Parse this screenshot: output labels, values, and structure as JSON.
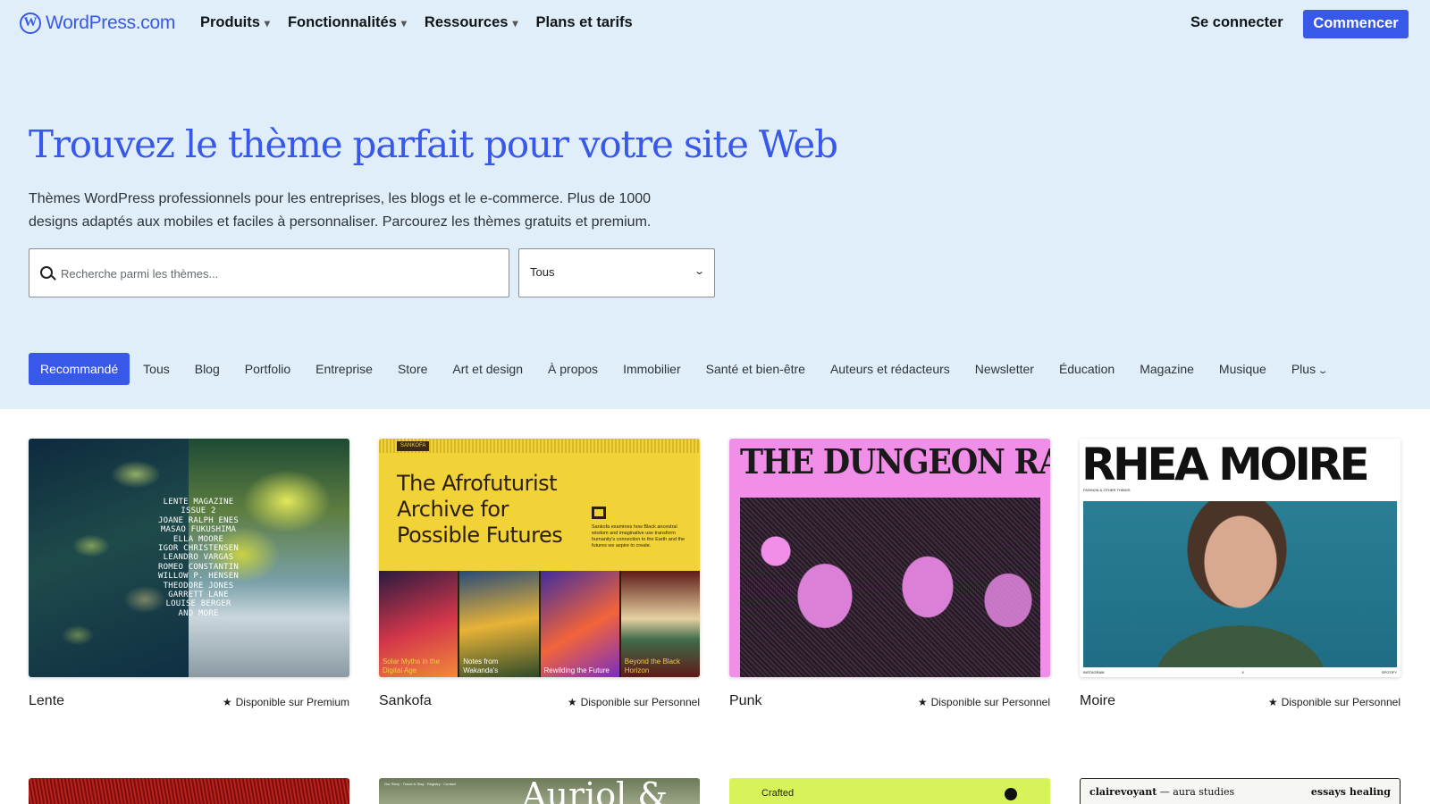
{
  "nav": {
    "logo": "WordPress.com",
    "links": [
      {
        "label": "Produits",
        "caret": "▾"
      },
      {
        "label": "Fonctionnalités",
        "caret": "▾"
      },
      {
        "label": "Ressources",
        "caret": "▾"
      },
      {
        "label": "Plans et tarifs",
        "caret": ""
      }
    ],
    "login": "Se connecter",
    "cta": "Commencer"
  },
  "hero": {
    "title": "Trouvez le thème parfait pour votre site Web",
    "description": "Thèmes WordPress professionnels pour les entreprises, les blogs et le e-commerce. Plus de 1000 designs adaptés aux mobiles et faciles à personnaliser. Parcourez les thèmes gratuits et premium.",
    "search_placeholder": "Recherche parmi les thèmes...",
    "search_value": "",
    "filter_value": "Tous"
  },
  "categories": {
    "items": [
      "Recommandé",
      "Tous",
      "Blog",
      "Portfolio",
      "Entreprise",
      "Store",
      "Art et design",
      "À propos",
      "Immobilier",
      "Santé et bien-être",
      "Auteurs et rédacteurs",
      "Newsletter",
      "Éducation",
      "Magazine",
      "Musique"
    ],
    "active": "Recommandé",
    "more": "Plus"
  },
  "themes": [
    {
      "name": "Lente",
      "badge": "Disponible sur Premium"
    },
    {
      "name": "Sankofa",
      "badge": "Disponible sur Personnel"
    },
    {
      "name": "Punk",
      "badge": "Disponible sur Personnel"
    },
    {
      "name": "Moire",
      "badge": "Disponible sur Personnel"
    }
  ],
  "previews": {
    "lente": {
      "lines": [
        "LENTE MAGAZINE",
        "ISSUE 2",
        "JOANE RALPH ENES",
        "MASAO FUKUSHIMA",
        "ELLA MOORE",
        "IGOR CHRISTENSEN",
        "LEANDRO VARGAS",
        "ROMEO CONSTANTIN",
        "WILLOW P. HENSEN",
        "THEODORE JONES",
        "GARRETT LANE",
        "LOUISE BERGER",
        "AND MORE"
      ]
    },
    "sankofa": {
      "tag": "SANKOFA",
      "title": "The Afrofuturist Archive for Possible Futures",
      "blurb": "Sankofa examines how Black ancestral wisdom and imaginative use transform humanity's connection to the Earth and the futures we aspire to create.",
      "books": [
        "Solar Myths in the Digital Age",
        "Notes from Wakanda's",
        "Rewilding the Future",
        "Beyond the Black Horizon"
      ]
    },
    "punk": {
      "title": "THE DUNGEON RABBITS"
    },
    "moire": {
      "title": "RHEA MOIRE",
      "subtitle": "FASHION & OTHER THINGS",
      "footer": [
        "INSTAGRAM",
        "X",
        "SPOTIFY"
      ]
    },
    "row2": {
      "auriol": "Auriol &",
      "auriol_nav": "Our Story · Travel & Stay · Registry · Contact",
      "crafted": "Crafted",
      "clairevoyant_name": "clairevoyant",
      "clairevoyant_rest": " — aura studies",
      "clairevoyant_nav": "essays   healing"
    }
  },
  "colors": {
    "accent": "#3858e9",
    "hero_bg": "#e0eefa"
  }
}
